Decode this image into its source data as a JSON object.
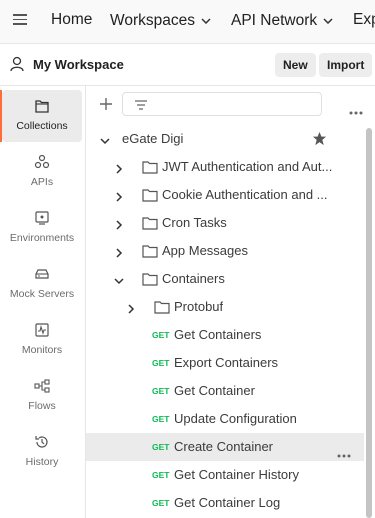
{
  "topnav": {
    "home": "Home",
    "workspaces": "Workspaces",
    "api_network": "API Network",
    "explore": "Exp"
  },
  "workspace": {
    "title": "My Workspace",
    "new_label": "New",
    "import_label": "Import"
  },
  "sidebar": {
    "items": [
      {
        "label": "Collections",
        "icon": "collections-icon"
      },
      {
        "label": "APIs",
        "icon": "apis-icon"
      },
      {
        "label": "Environments",
        "icon": "environments-icon"
      },
      {
        "label": "Mock Servers",
        "icon": "mock-servers-icon"
      },
      {
        "label": "Monitors",
        "icon": "monitors-icon"
      },
      {
        "label": "Flows",
        "icon": "flows-icon"
      },
      {
        "label": "History",
        "icon": "history-icon"
      }
    ]
  },
  "tree": {
    "collection": "eGate Digi",
    "folders": [
      "JWT Authentication and Aut...",
      "Cookie Authentication and ...",
      "Cron Tasks",
      "App Messages",
      "Containers"
    ],
    "subfolder": "Protobuf",
    "requests": [
      {
        "method": "GET",
        "name": "Get Containers"
      },
      {
        "method": "GET",
        "name": "Export Containers"
      },
      {
        "method": "GET",
        "name": "Get Container"
      },
      {
        "method": "GET",
        "name": "Update Configuration"
      },
      {
        "method": "GET",
        "name": "Create Container"
      },
      {
        "method": "GET",
        "name": "Get Container History"
      },
      {
        "method": "GET",
        "name": "Get Container Log"
      }
    ]
  },
  "colors": {
    "accent": "#ff6c37",
    "get_method": "#0cbb52"
  }
}
